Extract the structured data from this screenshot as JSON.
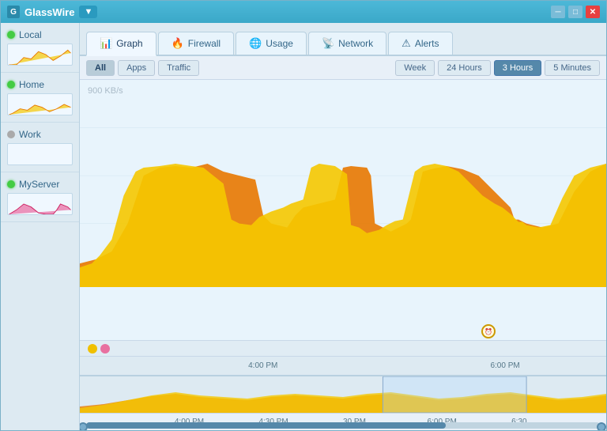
{
  "titleBar": {
    "appName": "GlassWire",
    "dropdownArrow": "▼",
    "minimizeLabel": "─",
    "maximizeLabel": "□",
    "closeLabel": "✕"
  },
  "sidebar": {
    "items": [
      {
        "id": "local",
        "label": "Local",
        "status": "green",
        "hasGraph": true
      },
      {
        "id": "home",
        "label": "Home",
        "status": "green",
        "hasGraph": true
      },
      {
        "id": "work",
        "label": "Work",
        "status": "gray",
        "hasGraph": false
      },
      {
        "id": "myserver",
        "label": "MyServer",
        "status": "green",
        "hasGraph": true
      }
    ]
  },
  "tabs": [
    {
      "id": "graph",
      "label": "Graph",
      "icon": "📊",
      "active": true
    },
    {
      "id": "firewall",
      "label": "Firewall",
      "icon": "🔥",
      "active": false
    },
    {
      "id": "usage",
      "label": "Usage",
      "icon": "🌐",
      "active": false
    },
    {
      "id": "network",
      "label": "Network",
      "icon": "📡",
      "active": false
    },
    {
      "id": "alerts",
      "label": "Alerts",
      "icon": "⚠",
      "active": false
    }
  ],
  "subBar": {
    "filters": [
      {
        "id": "all",
        "label": "All",
        "active": true
      },
      {
        "id": "apps",
        "label": "Apps",
        "active": false
      },
      {
        "id": "traffic",
        "label": "Traffic",
        "active": false
      }
    ],
    "timeFilters": [
      {
        "id": "week",
        "label": "Week",
        "active": false
      },
      {
        "id": "24hours",
        "label": "24 Hours",
        "active": false
      },
      {
        "id": "3hours",
        "label": "3 Hours",
        "active": true
      },
      {
        "id": "5minutes",
        "label": "5 Minutes",
        "active": false
      }
    ]
  },
  "graph": {
    "yAxisLabel": "900 KB/s",
    "xAxisLabels": [
      "4:00 PM",
      "6:00 PM"
    ],
    "miniLabels": [
      "4:00 PM",
      "4:30 PM",
      "30 PM",
      "6:00 PM",
      "6:30"
    ]
  },
  "colors": {
    "accent": "#3aa8c8",
    "chartYellow": "#f5c800",
    "chartOrange": "#e87800",
    "activeTab": "#5588aa"
  }
}
